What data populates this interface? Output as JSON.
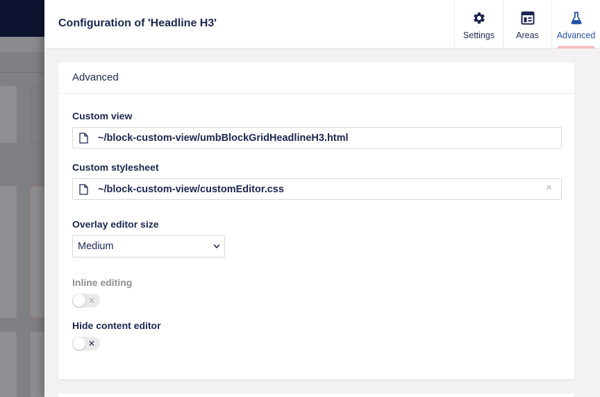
{
  "overlay": {
    "title": "Configuration of 'Headline H3'"
  },
  "tabs": [
    {
      "label": "Settings",
      "icon": "gear-icon"
    },
    {
      "label": "Areas",
      "icon": "layout-icon"
    },
    {
      "label": "Advanced",
      "icon": "flask-icon",
      "active": true
    }
  ],
  "panel": {
    "heading": "Advanced",
    "custom_view": {
      "label": "Custom view",
      "value": "~/block-custom-view/umbBlockGridHeadlineH3.html"
    },
    "custom_stylesheet": {
      "label": "Custom stylesheet",
      "value": "~/block-custom-view/customEditor.css",
      "remove_glyph": "×"
    },
    "overlay_size": {
      "label": "Overlay editor size",
      "value": "Medium"
    },
    "inline_editing": {
      "label": "Inline editing",
      "glyph": "✕",
      "on": false,
      "disabled": true
    },
    "hide_content_editor": {
      "label": "Hide content editor",
      "glyph": "✕",
      "on": false
    }
  },
  "colors": {
    "text_primary": "#1b264f",
    "active_tab": "#2152a3",
    "active_indicator": "#f5c1bc",
    "topbar": "#0d1330"
  }
}
